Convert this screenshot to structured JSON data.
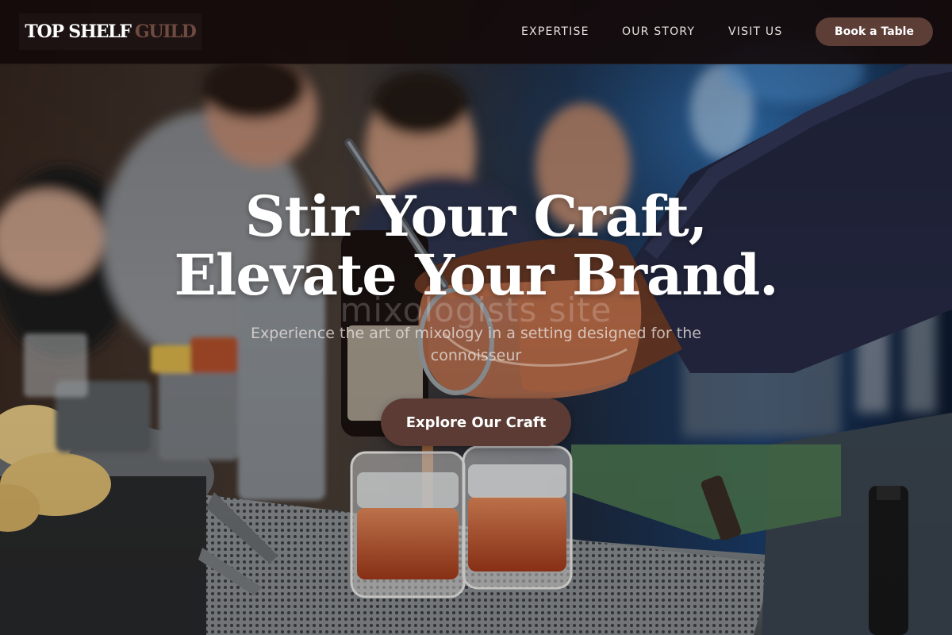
{
  "header": {
    "logo_primary": "TOP SHELF",
    "logo_secondary": "GUILD",
    "nav": [
      {
        "label": "EXPERTISE"
      },
      {
        "label": "OUR STORY"
      },
      {
        "label": "VISIT US"
      }
    ],
    "book_label": "Book a Table"
  },
  "hero": {
    "headline_line1": "Stir Your Craft,",
    "headline_line2": "Elevate Your Brand.",
    "watermark": "mixologists site",
    "subtitle": "Experience the art of mixology in a setting designed for the connoisseur",
    "cta_label": "Explore Our Craft",
    "image_subject": "bartender-pouring-cocktails-photo"
  },
  "colors": {
    "header_bg": "#140a0a",
    "accent": "#5d3e37",
    "logo_secondary": "#6e4a40",
    "text": "#ffffff"
  }
}
